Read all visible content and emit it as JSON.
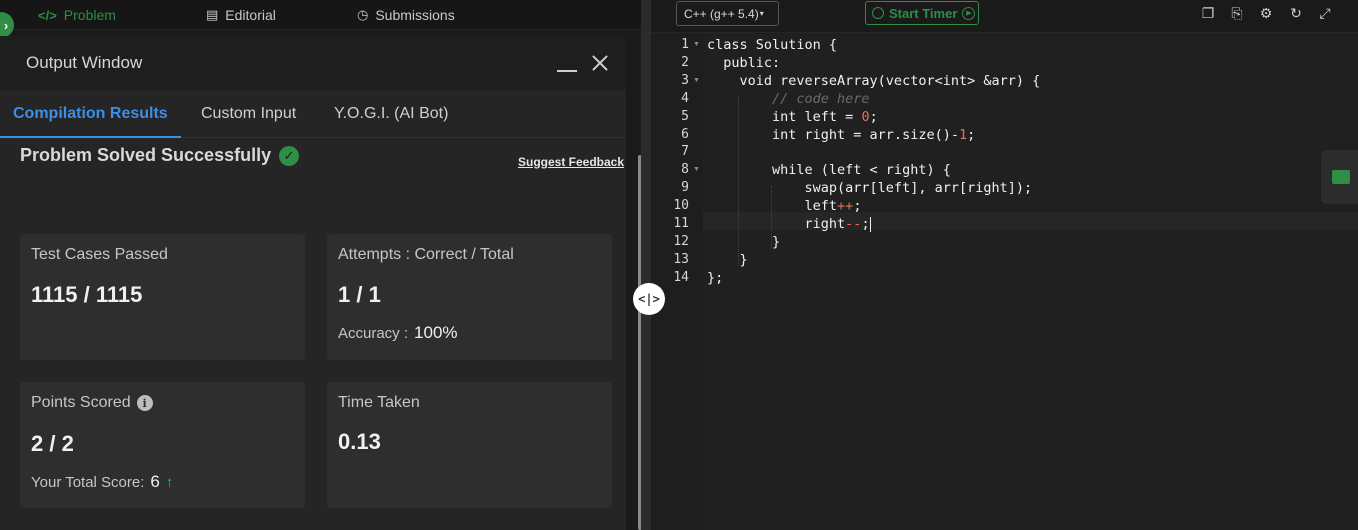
{
  "topnav": {
    "problem": "Problem",
    "editorial": "Editorial",
    "submissions": "Submissions"
  },
  "output_window": {
    "title": "Output Window",
    "tabs": [
      "Compilation Results",
      "Custom Input",
      "Y.O.G.I. (AI Bot)"
    ],
    "solved_title": "Problem Solved Successfully",
    "suggest_feedback": "Suggest Feedback",
    "cards": {
      "tests_label": "Test Cases Passed",
      "tests_value": "1115 / 1115",
      "attempts_label": "Attempts : Correct / Total",
      "attempts_value": "1 / 1",
      "accuracy_label": "Accuracy :",
      "accuracy_value": "100%",
      "points_label": "Points Scored",
      "points_value": "2 / 2",
      "total_score_label": "Your Total Score:",
      "total_score_value": "6",
      "time_label": "Time Taken",
      "time_value": "0.13"
    }
  },
  "editor": {
    "language": "C++ (g++ 5.4)",
    "start_timer": "Start Timer",
    "line_numbers": [
      "1",
      "2",
      "3",
      "4",
      "5",
      "6",
      "7",
      "8",
      "9",
      "10",
      "11",
      "12",
      "13",
      "14"
    ],
    "code_lines": [
      "class Solution {",
      "  public:",
      "    void reverseArray(vector<int> &arr) {",
      "        // code here",
      "        int left = 0;",
      "        int right = arr.size()-1;",
      "",
      "        while (left < right) {",
      "            swap(arr[left], arr[right]);",
      "            left++;",
      "            right--;",
      "        }",
      "    }",
      "};"
    ]
  },
  "colors": {
    "accent_green": "#2f8d46",
    "accent_blue": "#3d8ee8",
    "number_orange": "#e76f51"
  }
}
